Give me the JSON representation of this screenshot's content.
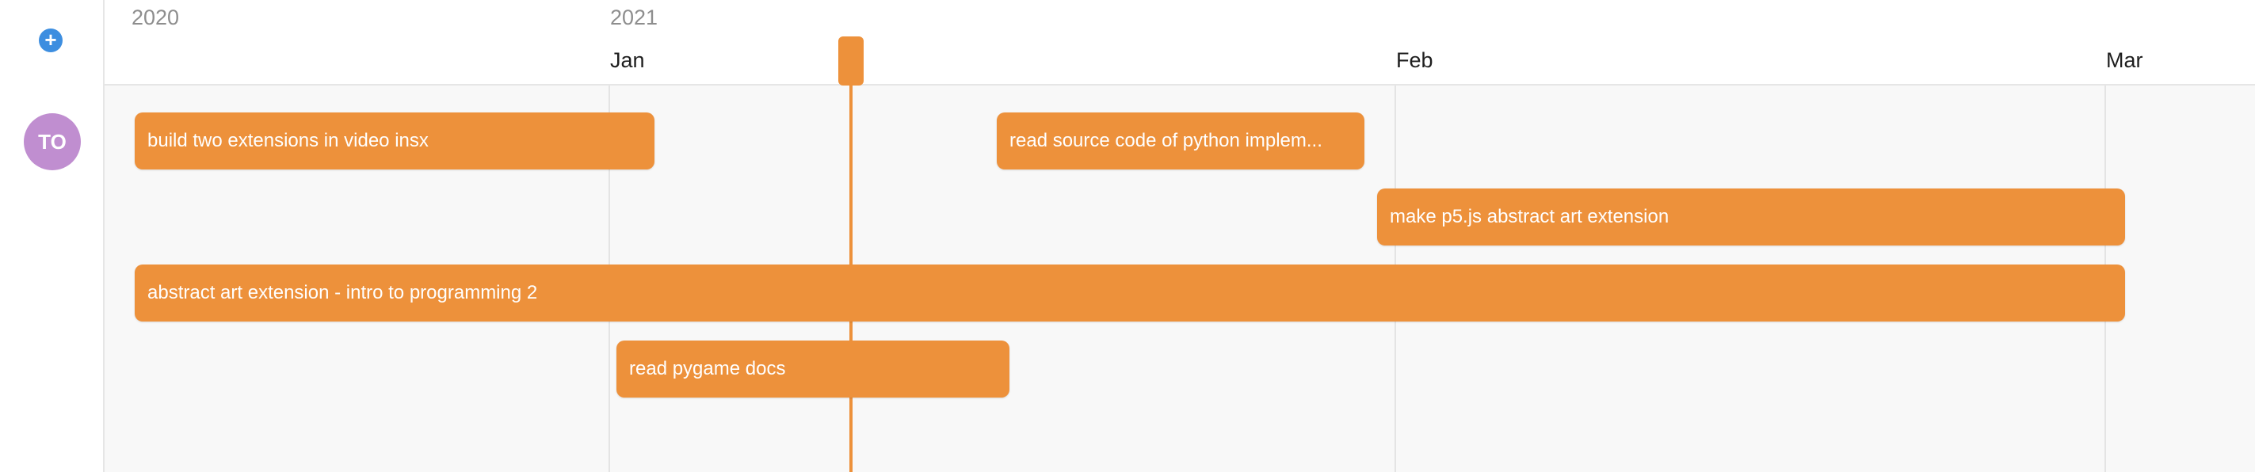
{
  "toolbar": {
    "add_label": "+"
  },
  "user": {
    "initials": "TO"
  },
  "timeline": {
    "years": [
      "2020",
      "2021"
    ],
    "months": [
      "Jan",
      "Feb",
      "Mar"
    ]
  },
  "tasks": [
    {
      "title": "build two extensions in video insx"
    },
    {
      "title": "read source code of python implem..."
    },
    {
      "title": "make p5.js abstract art extension"
    },
    {
      "title": "abstract art extension - intro to programming 2"
    },
    {
      "title": "read pygame docs"
    }
  ],
  "colors": {
    "bar": "#ed913b",
    "avatar": "#c08ed0",
    "add_button": "#3d8ee0"
  }
}
